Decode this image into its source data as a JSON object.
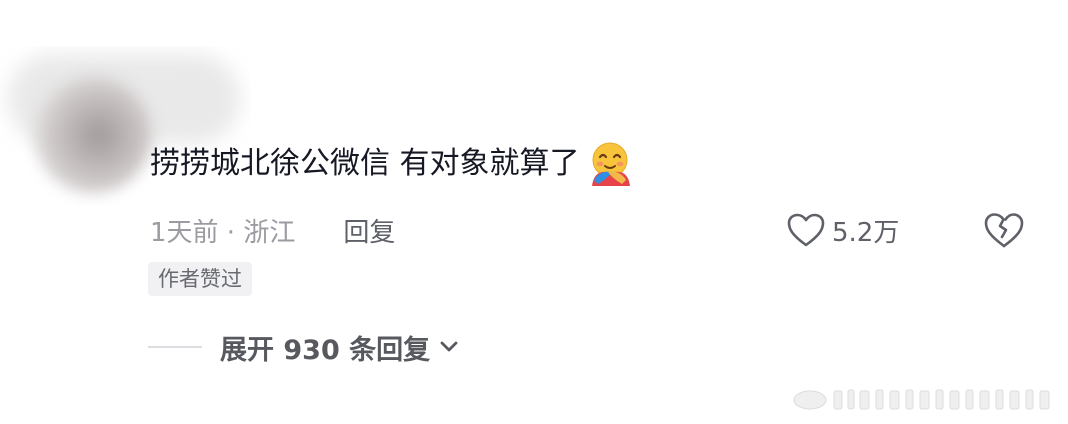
{
  "comment": {
    "text": "捞捞城北徐公微信 有对象就算了",
    "emoji": "hugging-face-emoji",
    "time_location": "1天前 · 浙江",
    "reply_label": "回复",
    "like_count": "5.2万",
    "author_badge": "作者赞过"
  },
  "replies": {
    "expand_label": "展开 930 条回复"
  },
  "icons": {
    "like": "heart-outline-icon",
    "dislike": "broken-heart-icon",
    "expand": "chevron-down-icon"
  },
  "colors": {
    "text_primary": "#161823",
    "text_secondary": "#9a9ca2",
    "text_action": "#5f6168",
    "badge_bg": "#f1f1f3"
  }
}
